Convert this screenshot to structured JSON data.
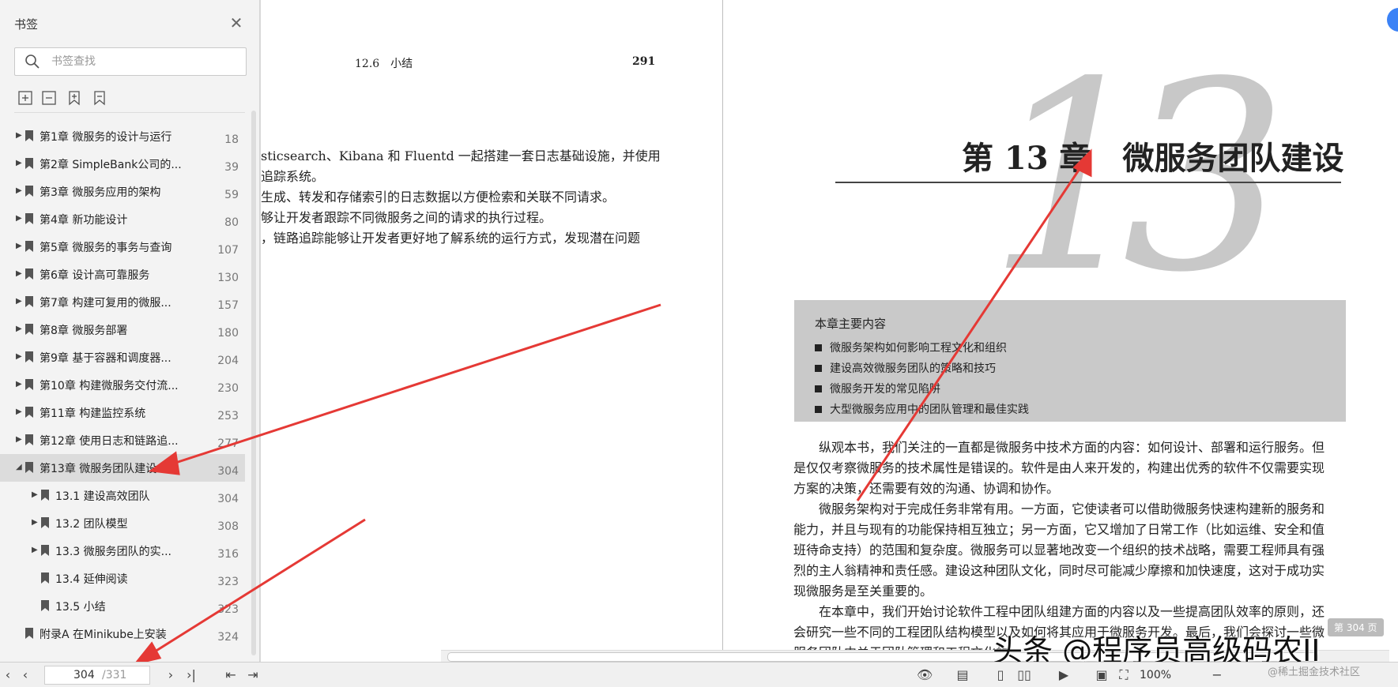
{
  "sidebar": {
    "title": "书签",
    "search_placeholder": "书签查找",
    "items": [
      {
        "label": "第1章 微服务的设计与运行",
        "page": "18",
        "level": 0,
        "has_children": true
      },
      {
        "label": "第2章 SimpleBank公司的...",
        "page": "39",
        "level": 0,
        "has_children": true
      },
      {
        "label": "第3章 微服务应用的架构",
        "page": "59",
        "level": 0,
        "has_children": true
      },
      {
        "label": "第4章 新功能设计",
        "page": "80",
        "level": 0,
        "has_children": true
      },
      {
        "label": "第5章 微服务的事务与查询",
        "page": "107",
        "level": 0,
        "has_children": true
      },
      {
        "label": "第6章 设计高可靠服务",
        "page": "130",
        "level": 0,
        "has_children": true
      },
      {
        "label": "第7章 构建可复用的微服...",
        "page": "157",
        "level": 0,
        "has_children": true
      },
      {
        "label": "第8章 微服务部署",
        "page": "180",
        "level": 0,
        "has_children": true
      },
      {
        "label": "第9章 基于容器和调度器...",
        "page": "204",
        "level": 0,
        "has_children": true
      },
      {
        "label": "第10章 构建微服务交付流...",
        "page": "230",
        "level": 0,
        "has_children": true
      },
      {
        "label": "第11章 构建监控系统",
        "page": "253",
        "level": 0,
        "has_children": true
      },
      {
        "label": "第12章 使用日志和链路追...",
        "page": "277",
        "level": 0,
        "has_children": true
      },
      {
        "label": "第13章 微服务团队建设",
        "page": "304",
        "level": 0,
        "has_children": true,
        "expanded": true,
        "selected": true
      },
      {
        "label": "13.1 建设高效团队",
        "page": "304",
        "level": 1,
        "has_children": true
      },
      {
        "label": "13.2 团队模型",
        "page": "308",
        "level": 1,
        "has_children": true
      },
      {
        "label": "13.3 微服务团队的实...",
        "page": "316",
        "level": 1,
        "has_children": true
      },
      {
        "label": "13.4 延伸阅读",
        "page": "323",
        "level": 1,
        "has_children": false
      },
      {
        "label": "13.5 小结",
        "page": "323",
        "level": 1,
        "has_children": false
      },
      {
        "label": "附录A 在Minikube上安装",
        "page": "324",
        "level": 0,
        "has_children": false
      }
    ]
  },
  "left_page": {
    "section": "12.6　小结",
    "page_number": "291",
    "lines": [
      "sticsearch、Kibana 和 Fluentd 一起搭建一套日志基础设施，并使用",
      "追踪系统。",
      "生成、转发和存储索引的日志数据以方便检索和关联不同请求。",
      "够让开发者跟踪不同微服务之间的请求的执行过程。",
      "，链路追踪能够让开发者更好地了解系统的运行方式，发现潜在问题"
    ]
  },
  "right_page": {
    "big_number": "13",
    "chapter_title": "第 13 章　微服务团队建设",
    "box_title": "本章主要内容",
    "box_items": [
      "微服务架构如何影响工程文化和组织",
      "建设高效微服务团队的策略和技巧",
      "微服务开发的常见陷阱",
      "大型微服务应用中的团队管理和最佳实践"
    ],
    "body_lines": [
      "　　纵观本书，我们关注的一直都是微服务中技术方面的内容：如何设计、部署和运行服务。但",
      "是仅仅考察微服务的技术属性是错误的。软件是由人来开发的，构建出优秀的软件不仅需要实现",
      "方案的决策，还需要有效的沟通、协调和协作。",
      "　　微服务架构对于完成任务非常有用。一方面，它使读者可以借助微服务快速构建新的服务和",
      "能力，并且与现有的功能保持相互独立；另一方面，它又增加了日常工作（比如运维、安全和值",
      "班待命支持）的范围和复杂度。微服务可以显著地改变一个组织的技术战略，需要工程师具有强",
      "烈的主人翁精神和责任感。建设这种团队文化，同时尽可能减少摩擦和加快速度，这对于成功实",
      "现微服务是至关重要的。",
      "　　在本章中，我们开始讨论软件工程中团队组建方面的内容以及一些提高团队效率的原则，还",
      "会研究一些不同的工程团队结构模型以及如何将其应用于微服务开发。最后，我们会探讨一些微",
      "服务团队中关于团队管理和工程文化的..."
    ]
  },
  "overlay": {
    "watermark": "头条 @程序员高级码农II",
    "page_indicator": "第 304 页",
    "copyright": "@稀土掘金技术社区"
  },
  "bottombar": {
    "current_page": "304",
    "total_pages": "/331",
    "zoom": "100%"
  },
  "colors": {
    "arrow": "#e53935",
    "selected_row": "#dcdcdc",
    "box_bg": "#c9c9c9"
  }
}
